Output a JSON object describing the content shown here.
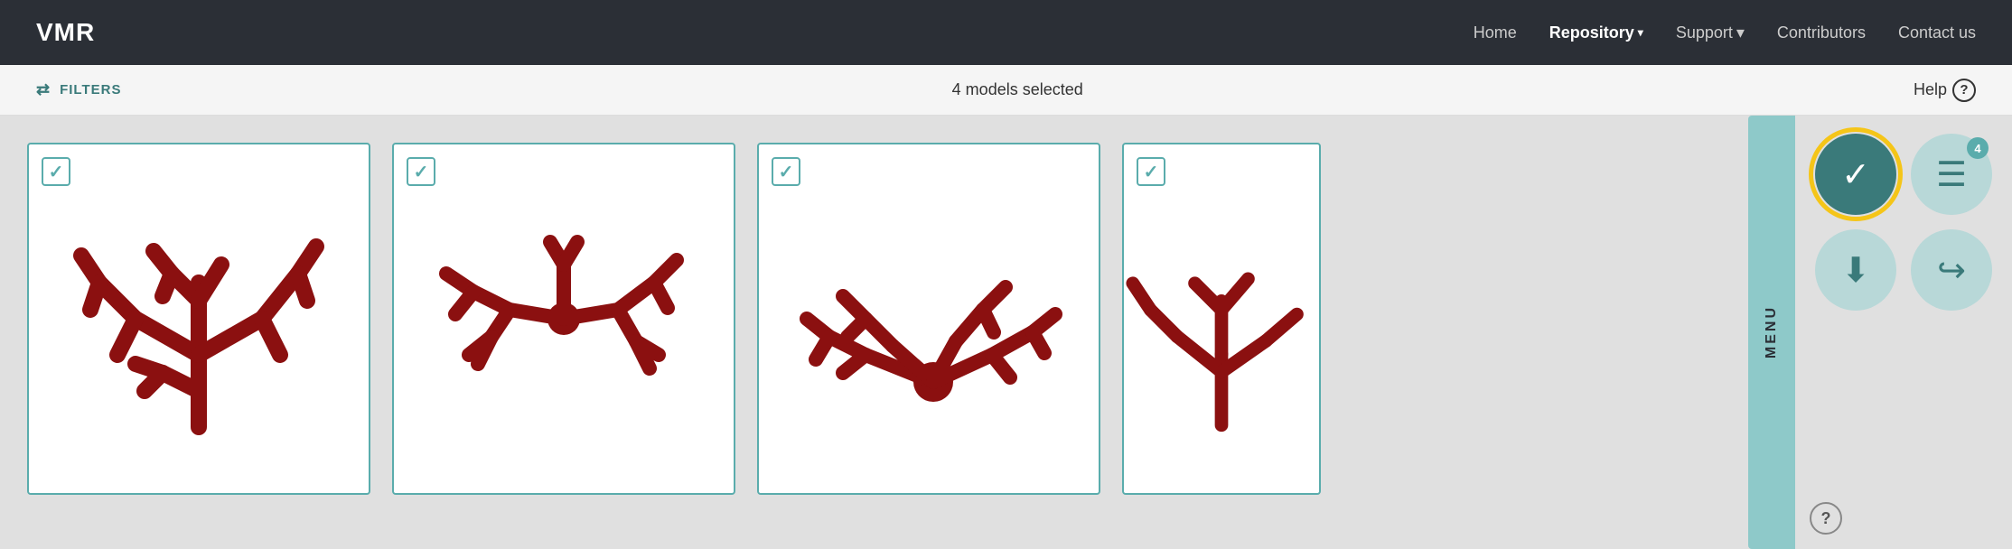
{
  "navbar": {
    "brand": "VMR",
    "links": [
      {
        "id": "home",
        "label": "Home",
        "active": false
      },
      {
        "id": "repository",
        "label": "Repository",
        "active": true,
        "dropdown": true
      },
      {
        "id": "support",
        "label": "Support",
        "active": false,
        "dropdown": true
      },
      {
        "id": "contributors",
        "label": "Contributors",
        "active": false
      },
      {
        "id": "contact",
        "label": "Contact us",
        "active": false
      }
    ]
  },
  "subbar": {
    "filters_label": "FILTERS",
    "models_selected": "4 models selected",
    "help_label": "Help"
  },
  "menu": {
    "tab_label": "MENU",
    "buttons": [
      {
        "id": "select",
        "label": "Select",
        "style": "teal",
        "highlighted": true
      },
      {
        "id": "collection",
        "label": "Collection",
        "style": "light",
        "badge": "4"
      },
      {
        "id": "download",
        "label": "Download",
        "style": "light"
      },
      {
        "id": "share",
        "label": "Share",
        "style": "light"
      }
    ]
  },
  "models": [
    {
      "id": "model-1",
      "checked": true
    },
    {
      "id": "model-2",
      "checked": true
    },
    {
      "id": "model-3",
      "checked": true
    },
    {
      "id": "model-4",
      "checked": true
    }
  ]
}
